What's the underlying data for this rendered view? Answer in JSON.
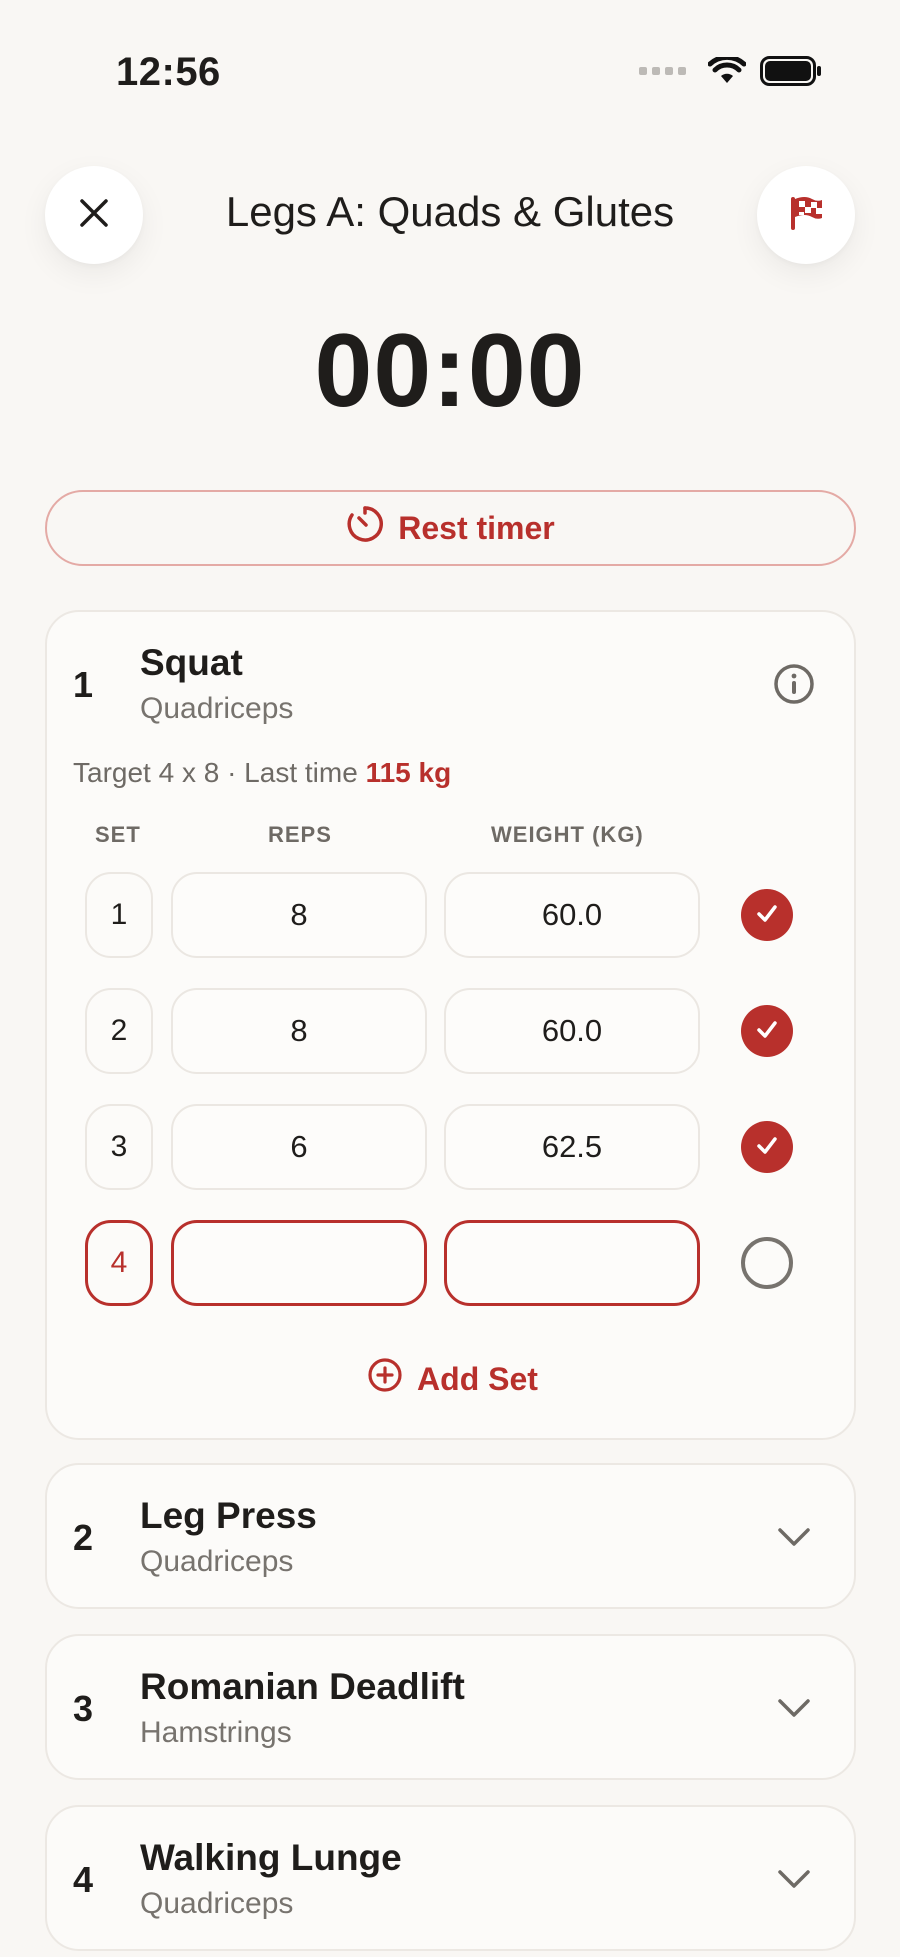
{
  "status": {
    "time": "12:56"
  },
  "header": {
    "title": "Legs A: Quads & Glutes",
    "timer": "00:00"
  },
  "rest_timer": {
    "label": "Rest timer"
  },
  "current_exercise": {
    "number": "1",
    "name": "Squat",
    "muscle": "Quadriceps",
    "target_prefix": "Target 4 x 8 · Last time ",
    "last_time": "115 kg",
    "columns": {
      "set": "SET",
      "reps": "REPS",
      "weight": "WEIGHT (KG)"
    },
    "sets": [
      {
        "set": "1",
        "reps": "8",
        "weight": "60.0",
        "done": true
      },
      {
        "set": "2",
        "reps": "8",
        "weight": "60.0",
        "done": true
      },
      {
        "set": "3",
        "reps": "6",
        "weight": "62.5",
        "done": true
      },
      {
        "set": "4",
        "reps": "",
        "weight": "",
        "done": false
      }
    ],
    "add_set": "Add Set"
  },
  "exercises": [
    {
      "number": "2",
      "name": "Leg Press",
      "muscle": "Quadriceps"
    },
    {
      "number": "3",
      "name": "Romanian Deadlift",
      "muscle": "Hamstrings"
    },
    {
      "number": "4",
      "name": "Walking Lunge",
      "muscle": "Quadriceps"
    }
  ],
  "colors": {
    "accent": "#b8302c",
    "background": "#f9f7f4"
  },
  "icons": {
    "close": "close-icon",
    "finish": "checkered-flag-icon",
    "timer": "stopwatch-icon",
    "info": "info-icon",
    "check": "checkmark-icon",
    "add": "plus-circle-icon",
    "expand": "chevron-down-icon"
  }
}
